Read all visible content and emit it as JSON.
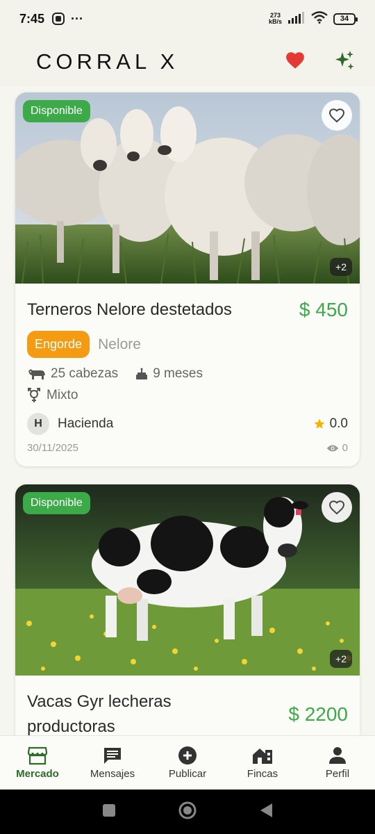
{
  "status_bar": {
    "time": "7:45",
    "net_speed": "273",
    "net_unit": "kB/s",
    "battery": "34",
    "more": "···"
  },
  "app": {
    "logo": "CORRAL X"
  },
  "listings": [
    {
      "status": "Disponible",
      "title": "Terneros Nelore destetados",
      "price": "$ 450",
      "purpose": "Engorde",
      "breed": "Nelore",
      "quantity": "25 cabezas",
      "age": "9 meses",
      "sex": "Mixto",
      "seller_initial": "H",
      "seller": "Hacienda",
      "rating": "0.0",
      "date": "30/11/2025",
      "views": "0",
      "more_photos": "+2"
    },
    {
      "status": "Disponible",
      "title": "Vacas Gyr lecheras productoras",
      "price": "$ 2200",
      "more_photos": "+2"
    }
  ],
  "bottom_nav": [
    {
      "label": "Mercado",
      "icon": "store-icon",
      "active": true
    },
    {
      "label": "Mensajes",
      "icon": "message-icon",
      "active": false
    },
    {
      "label": "Publicar",
      "icon": "add-circle-icon",
      "active": false
    },
    {
      "label": "Fincas",
      "icon": "farm-icon",
      "active": false
    },
    {
      "label": "Perfil",
      "icon": "person-icon",
      "active": false
    }
  ],
  "colors": {
    "primary_green": "#3daa4a",
    "accent_orange": "#f59b12",
    "heart_red": "#e53935",
    "nav_active": "#2e6a2a"
  }
}
